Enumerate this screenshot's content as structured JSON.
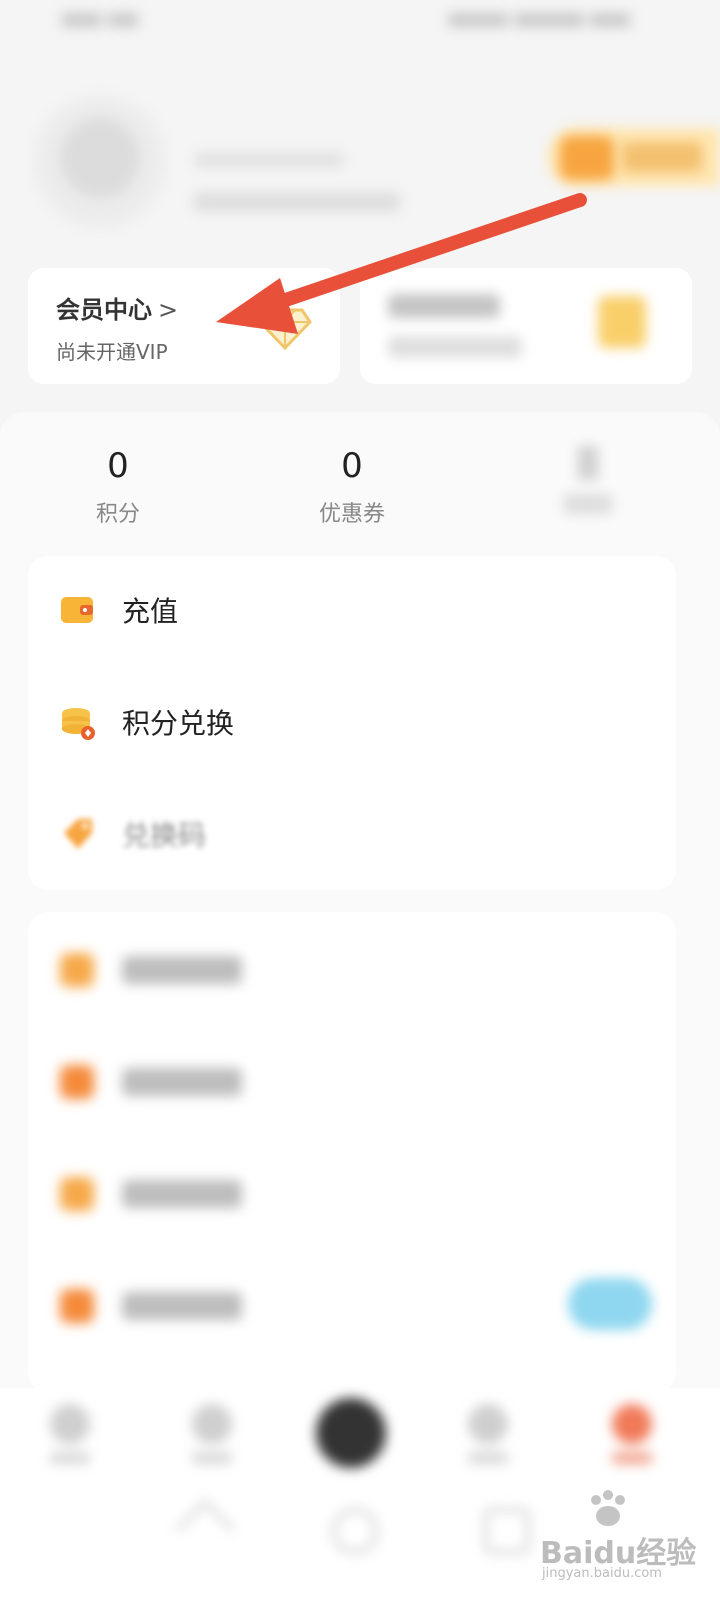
{
  "member_card": {
    "title": "会员中心",
    "chevron": ">",
    "subtitle": "尚未开通VIP"
  },
  "stats": [
    {
      "value": "0",
      "label": "积分"
    },
    {
      "value": "0",
      "label": "优惠券"
    }
  ],
  "menu": [
    {
      "label": "充值",
      "icon": "wallet-icon"
    },
    {
      "label": "积分兑换",
      "icon": "coins-icon"
    },
    {
      "label": "兑换码",
      "icon": "tag-icon"
    }
  ],
  "colors": {
    "accent_orange": "#f7a540",
    "arrow_red": "#e8503a",
    "diamond_gold": "#f3c46a"
  },
  "watermark": {
    "logo_text": "Baidu经验",
    "url": "jingyan.baidu.com"
  }
}
